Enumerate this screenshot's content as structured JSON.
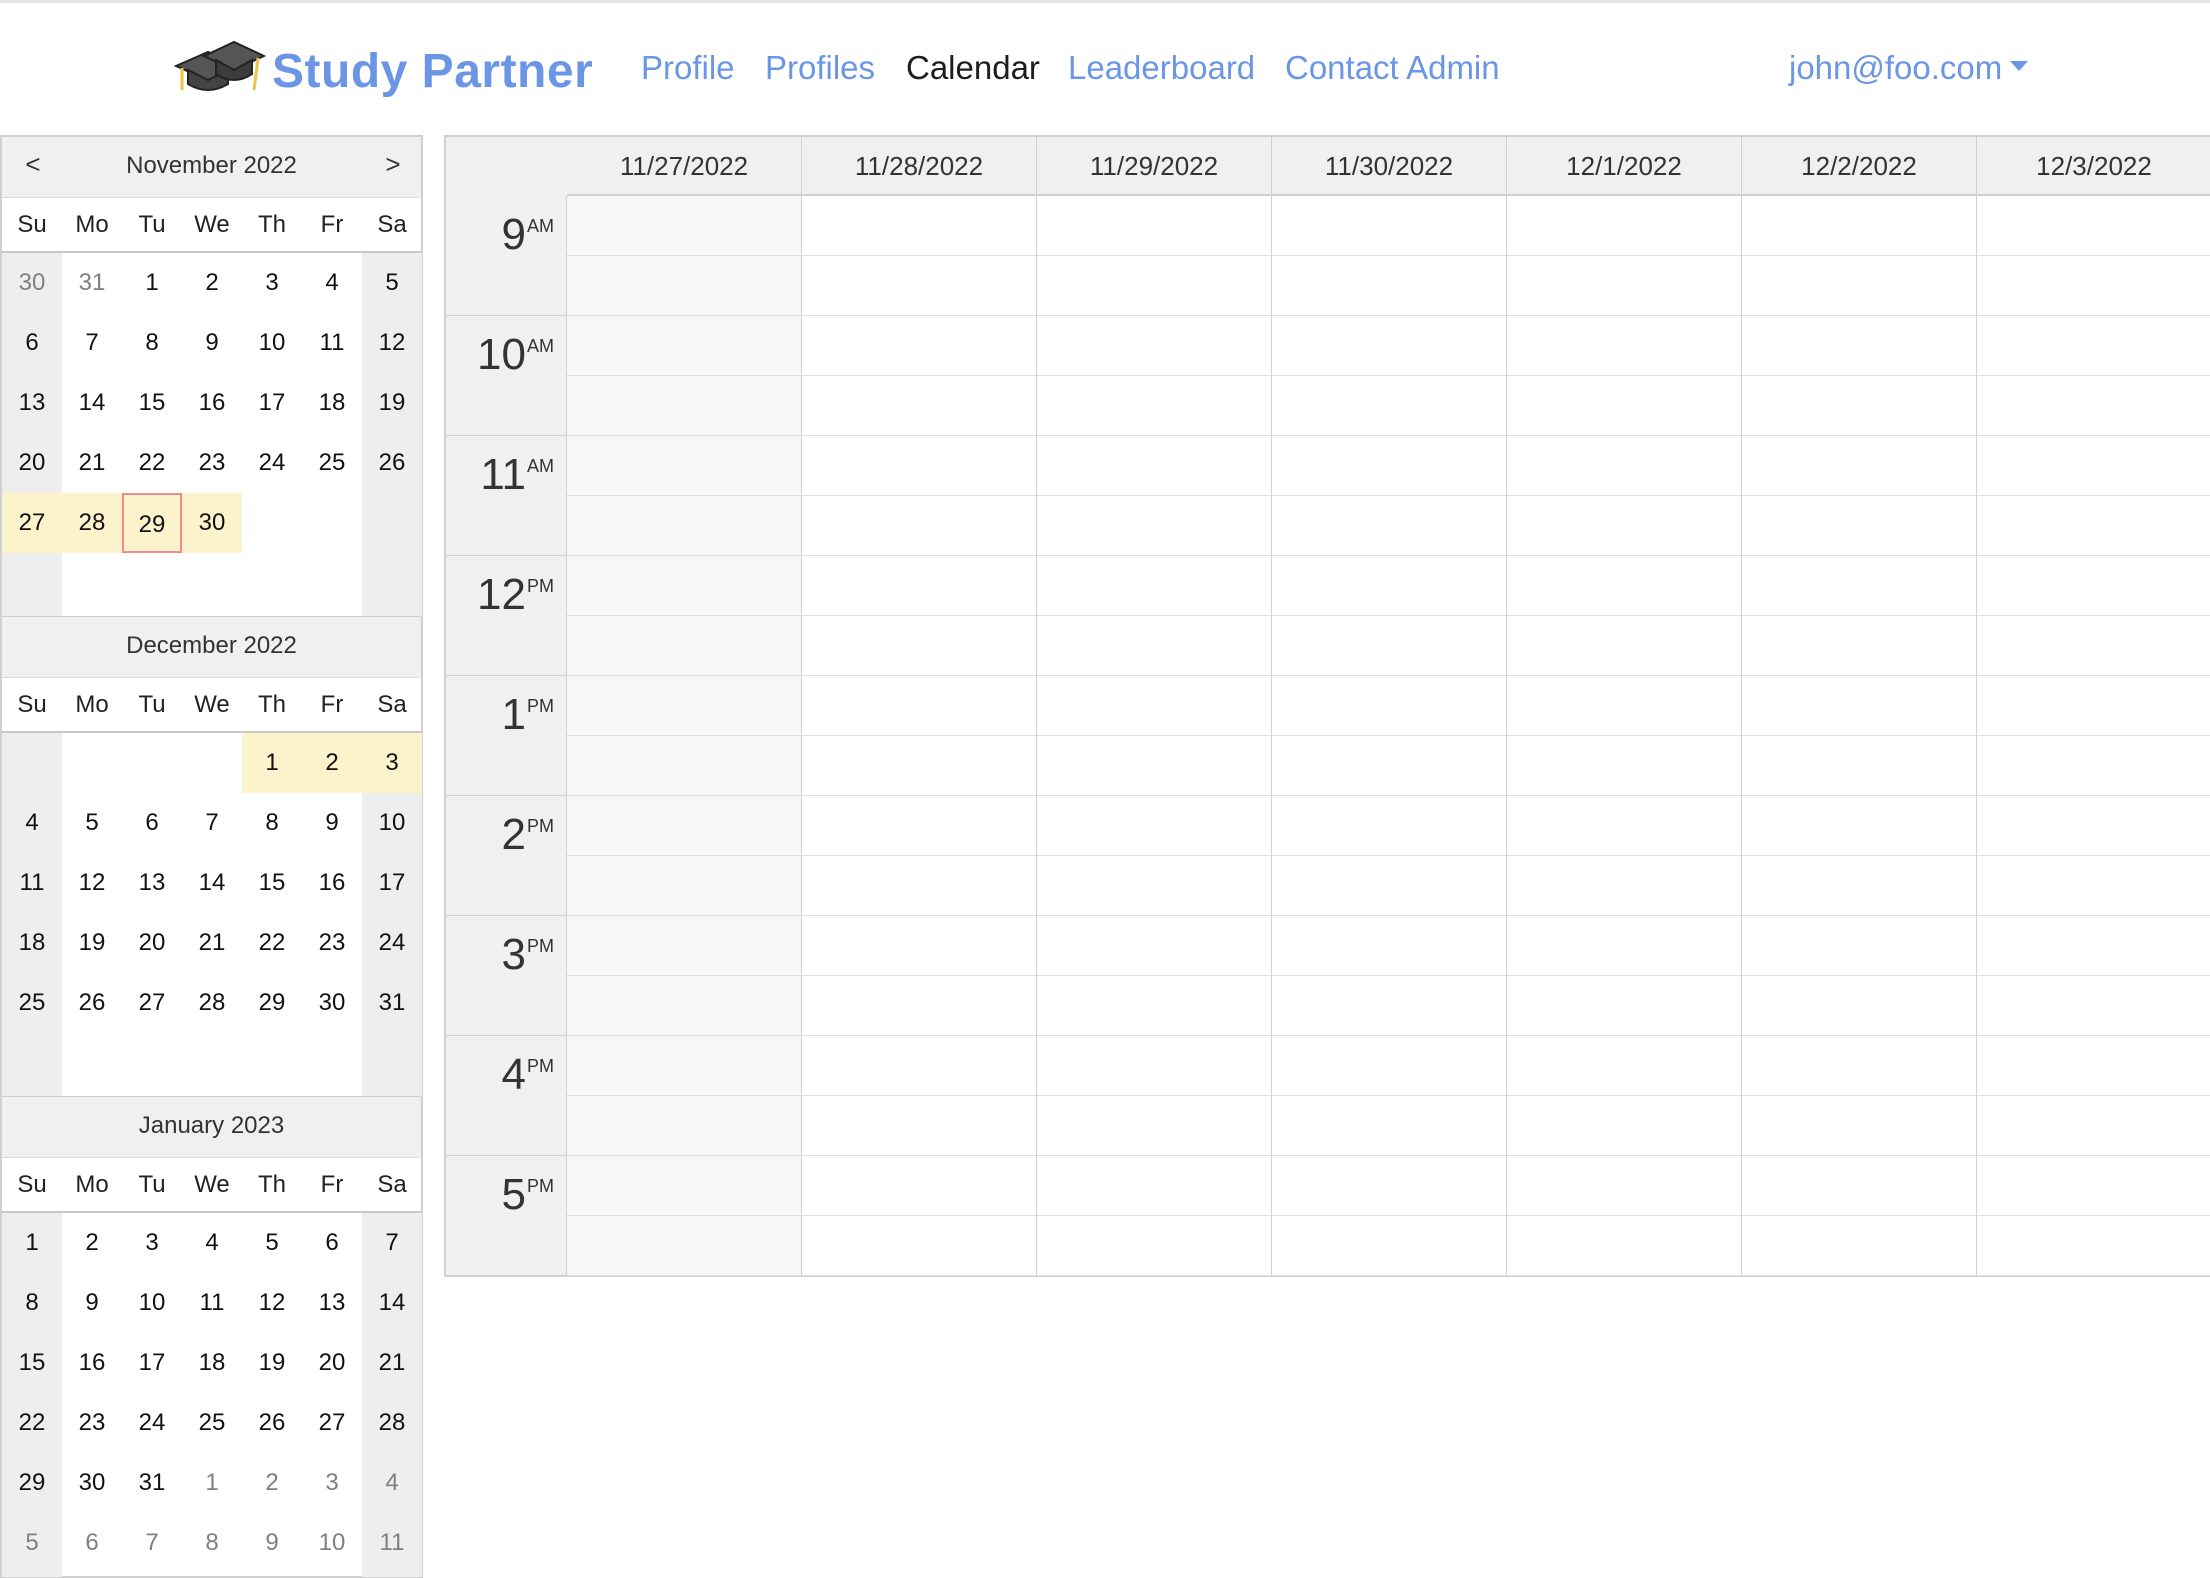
{
  "nav": {
    "brand": "Study Partner",
    "links": [
      "Profile",
      "Profiles",
      "Calendar",
      "Leaderboard",
      "Contact Admin"
    ],
    "active": "Calendar",
    "user": "john@foo.com"
  },
  "mini_calendar": {
    "prev": "<",
    "next": ">",
    "dow": [
      "Su",
      "Mo",
      "Tu",
      "We",
      "Th",
      "Fr",
      "Sa"
    ],
    "months": [
      {
        "title": "November 2022",
        "weeks": [
          [
            "30",
            "31",
            "1",
            "2",
            "3",
            "4",
            "5"
          ],
          [
            "6",
            "7",
            "8",
            "9",
            "10",
            "11",
            "12"
          ],
          [
            "13",
            "14",
            "15",
            "16",
            "17",
            "18",
            "19"
          ],
          [
            "20",
            "21",
            "22",
            "23",
            "24",
            "25",
            "26"
          ],
          [
            "27",
            "28",
            "29",
            "30",
            "",
            "",
            ""
          ],
          [
            "",
            "",
            "",
            "",
            "",
            "",
            ""
          ]
        ],
        "other_month": [
          [
            0,
            0
          ],
          [
            0,
            1
          ]
        ],
        "selected_week": [
          [
            4,
            0
          ],
          [
            4,
            1
          ],
          [
            4,
            2
          ],
          [
            4,
            3
          ]
        ],
        "today": [
          4,
          2
        ]
      },
      {
        "title": "December 2022",
        "weeks": [
          [
            "",
            "",
            "",
            "",
            "1",
            "2",
            "3"
          ],
          [
            "4",
            "5",
            "6",
            "7",
            "8",
            "9",
            "10"
          ],
          [
            "11",
            "12",
            "13",
            "14",
            "15",
            "16",
            "17"
          ],
          [
            "18",
            "19",
            "20",
            "21",
            "22",
            "23",
            "24"
          ],
          [
            "25",
            "26",
            "27",
            "28",
            "29",
            "30",
            "31"
          ],
          [
            "",
            "",
            "",
            "",
            "",
            "",
            ""
          ]
        ],
        "other_month": [],
        "selected_week": [
          [
            0,
            4
          ],
          [
            0,
            5
          ],
          [
            0,
            6
          ]
        ],
        "today": null
      },
      {
        "title": "January 2023",
        "weeks": [
          [
            "1",
            "2",
            "3",
            "4",
            "5",
            "6",
            "7"
          ],
          [
            "8",
            "9",
            "10",
            "11",
            "12",
            "13",
            "14"
          ],
          [
            "15",
            "16",
            "17",
            "18",
            "19",
            "20",
            "21"
          ],
          [
            "22",
            "23",
            "24",
            "25",
            "26",
            "27",
            "28"
          ],
          [
            "29",
            "30",
            "31",
            "1",
            "2",
            "3",
            "4"
          ],
          [
            "5",
            "6",
            "7",
            "8",
            "9",
            "10",
            "11"
          ]
        ],
        "other_month": [
          [
            4,
            3
          ],
          [
            4,
            4
          ],
          [
            4,
            5
          ],
          [
            4,
            6
          ],
          [
            5,
            0
          ],
          [
            5,
            1
          ],
          [
            5,
            2
          ],
          [
            5,
            3
          ],
          [
            5,
            4
          ],
          [
            5,
            5
          ],
          [
            5,
            6
          ]
        ],
        "selected_week": [],
        "today": null
      }
    ]
  },
  "week_view": {
    "days": [
      "11/27/2022",
      "11/28/2022",
      "11/29/2022",
      "11/30/2022",
      "12/1/2022",
      "12/2/2022",
      "12/3/2022"
    ],
    "hours": [
      {
        "num": "9",
        "ampm": "AM"
      },
      {
        "num": "10",
        "ampm": "AM"
      },
      {
        "num": "11",
        "ampm": "AM"
      },
      {
        "num": "12",
        "ampm": "PM"
      },
      {
        "num": "1",
        "ampm": "PM"
      },
      {
        "num": "2",
        "ampm": "PM"
      },
      {
        "num": "3",
        "ampm": "PM"
      },
      {
        "num": "4",
        "ampm": "PM"
      },
      {
        "num": "5",
        "ampm": "PM"
      }
    ]
  },
  "colors": {
    "accent": "#6b96e6",
    "selected_week": "#fcf2cc",
    "today_border": "#f28b8b"
  }
}
